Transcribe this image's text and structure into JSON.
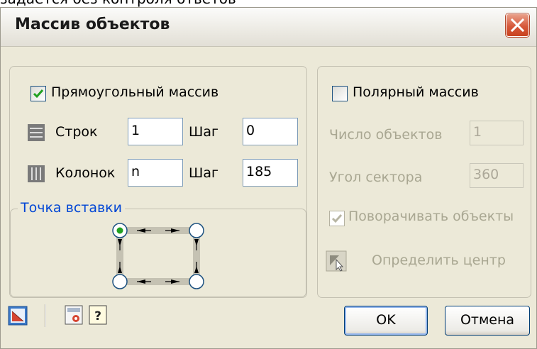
{
  "fragment_text": "задается без контроля ответов",
  "dialog": {
    "title": "Массив объектов"
  },
  "rect": {
    "enabled_label": "Прямоугольный массив",
    "enabled": true,
    "rows_label": "Строк",
    "rows_value": "1",
    "row_step_label": "Шаг",
    "row_step_value": "0",
    "cols_label": "Колонок",
    "cols_value": "n",
    "col_step_label": "Шаг",
    "col_step_value": "185",
    "insertion_point_label": "Точка вставки"
  },
  "polar": {
    "enabled_label": "Полярный массив",
    "enabled": false,
    "count_label": "Число объектов",
    "count_value": "1",
    "angle_label": "Угол сектора",
    "angle_value": "360",
    "rotate_label": "Поворачивать объекты",
    "rotate": true,
    "center_label": "Определить центр"
  },
  "buttons": {
    "ok": "OK",
    "cancel": "Отмена"
  },
  "colors": {
    "accent": "#0046d5",
    "close": "#d7593b",
    "dialog_bg": "#ece9d8"
  }
}
